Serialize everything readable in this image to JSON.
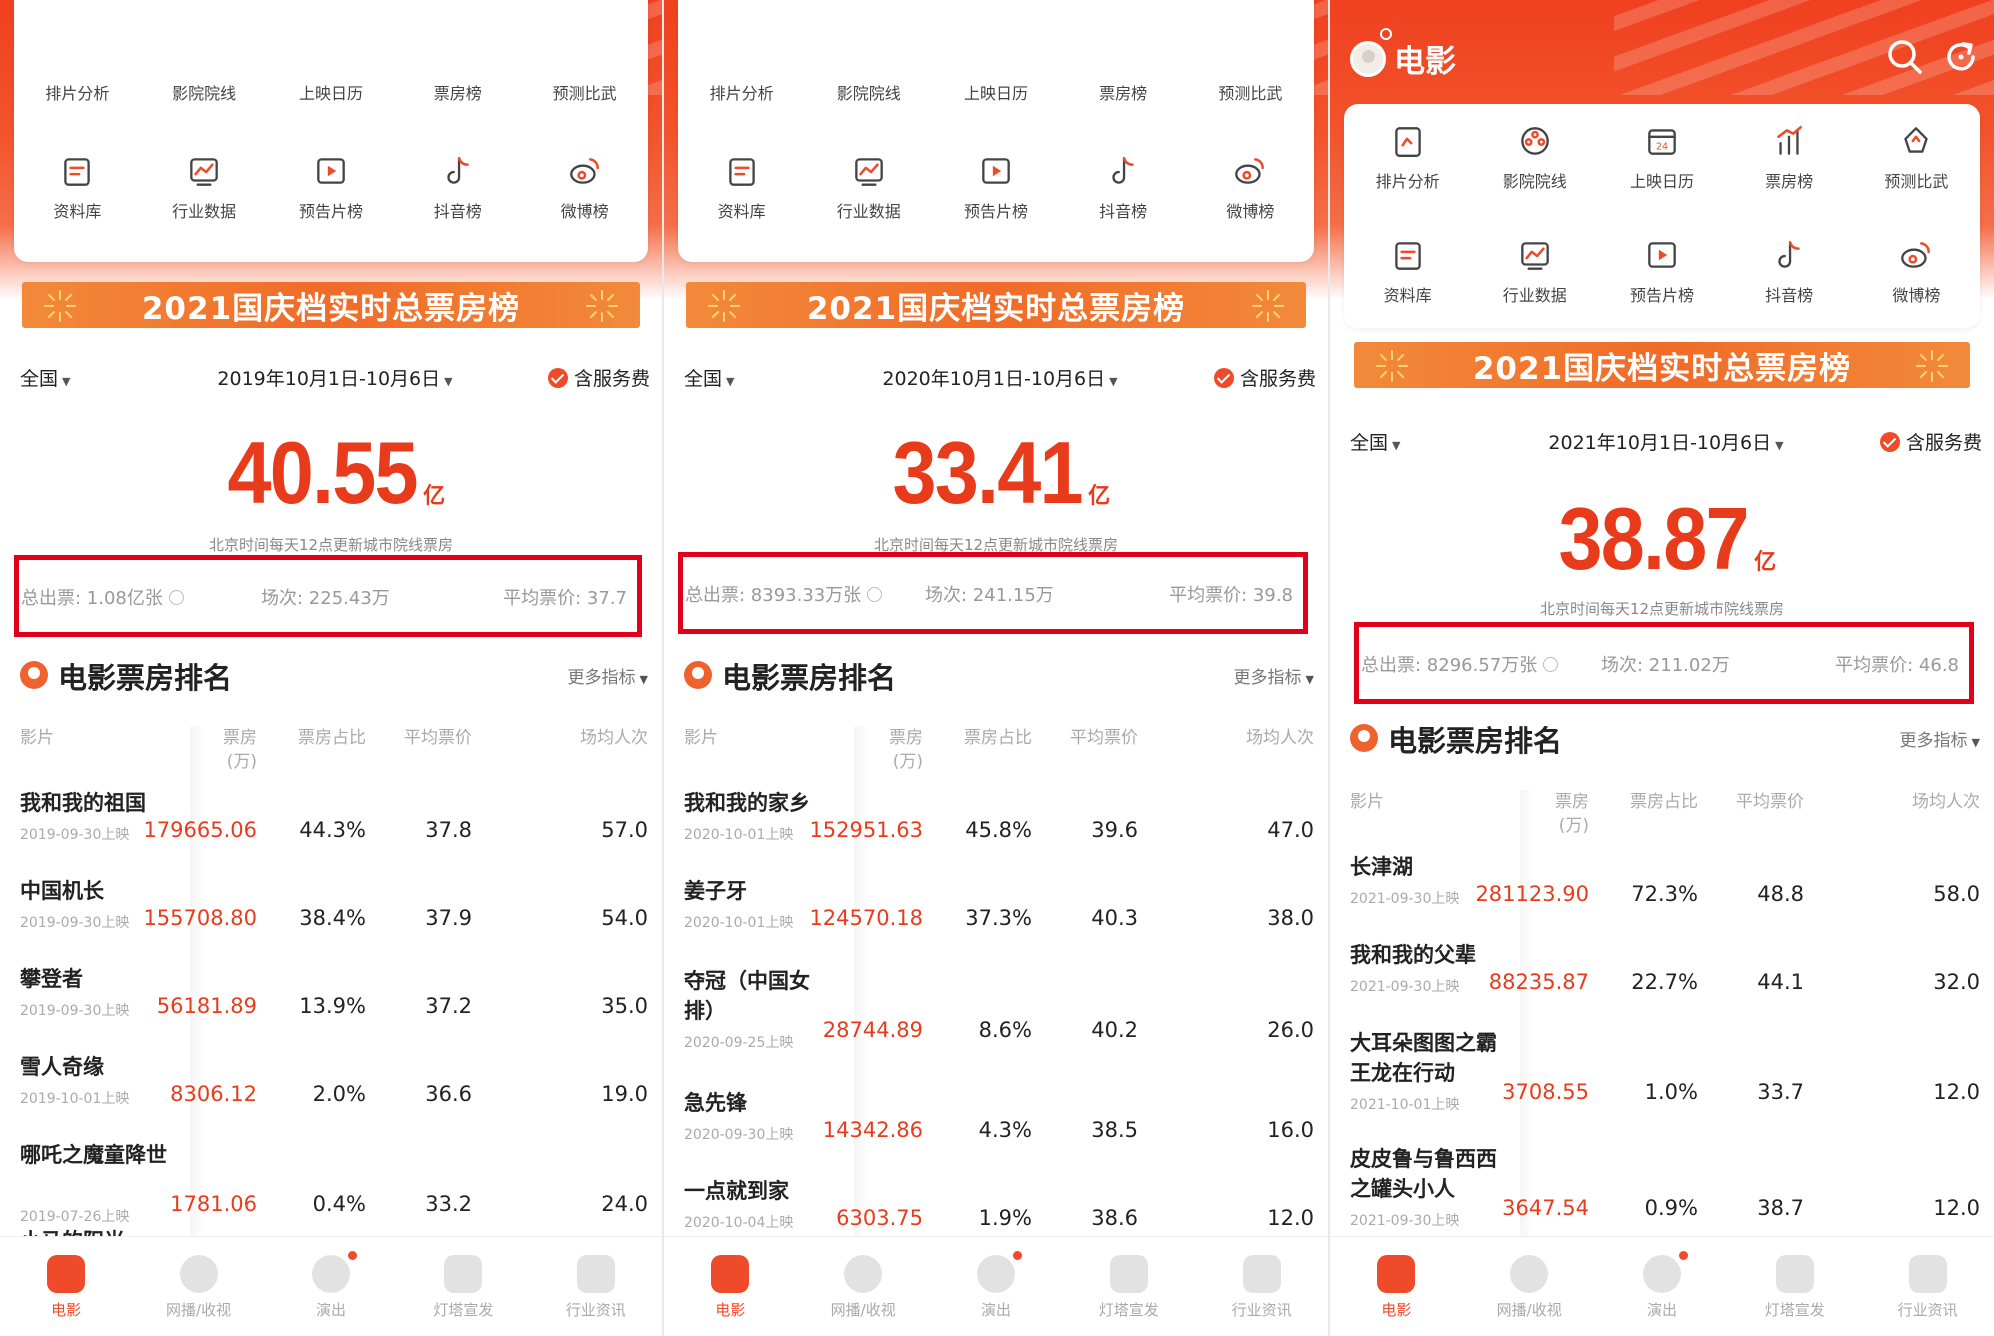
{
  "header": {
    "app_title": "电影"
  },
  "quick_grid": [
    {
      "label": "排片分析",
      "icon": "schedule-analysis-icon"
    },
    {
      "label": "影院院线",
      "icon": "cinema-chain-icon"
    },
    {
      "label": "上映日历",
      "icon": "release-calendar-icon"
    },
    {
      "label": "票房榜",
      "icon": "box-office-chart-icon"
    },
    {
      "label": "预测比武",
      "icon": "prediction-contest-icon"
    },
    {
      "label": "资料库",
      "icon": "database-icon"
    },
    {
      "label": "行业数据",
      "icon": "industry-data-icon"
    },
    {
      "label": "预告片榜",
      "icon": "trailer-chart-icon"
    },
    {
      "label": "抖音榜",
      "icon": "douyin-icon"
    },
    {
      "label": "微博榜",
      "icon": "weibo-icon"
    }
  ],
  "banner_title": "2021国庆档实时总票房榜",
  "region": "全国",
  "fee_label": "含服务费",
  "update_note": "北京时间每天12点更新城市院线票房",
  "unit_yi": "亿",
  "section": {
    "title": "电影票房排名",
    "more": "更多指标"
  },
  "table_headers": {
    "film": "影片",
    "box_office": "票房",
    "box_office_unit": "(万)",
    "share": "票房占比",
    "avg_price": "平均票价",
    "avg_attendance": "场均人次"
  },
  "tabs": [
    {
      "label": "电影",
      "active": true
    },
    {
      "label": "网播/收视",
      "active": false
    },
    {
      "label": "演出",
      "active": false
    },
    {
      "label": "灯塔宣发",
      "active": false
    },
    {
      "label": "行业资讯",
      "active": false
    }
  ],
  "accent_color": "#ef4a2a",
  "highlight_color": "#e0001a",
  "panels": [
    {
      "date_range": "2019年10月1日-10月6日",
      "total": "40.55",
      "stats": {
        "tickets": "总出票: 1.08亿张",
        "shows": "场次: 225.43万",
        "avg_price": "平均票价: 37.7"
      },
      "rows": [
        {
          "name": "我和我的祖国",
          "date": "2019-09-30上映",
          "box_office": "179665.06",
          "share": "44.3%",
          "avg_price": "37.8",
          "attendance": "57.0"
        },
        {
          "name": "中国机长",
          "date": "2019-09-30上映",
          "box_office": "155708.80",
          "share": "38.4%",
          "avg_price": "37.9",
          "attendance": "54.0"
        },
        {
          "name": "攀登者",
          "date": "2019-09-30上映",
          "box_office": "56181.89",
          "share": "13.9%",
          "avg_price": "37.2",
          "attendance": "35.0"
        },
        {
          "name": "雪人奇缘",
          "date": "2019-10-01上映",
          "box_office": "8306.12",
          "share": "2.0%",
          "avg_price": "36.6",
          "attendance": "19.0"
        },
        {
          "name": "哪吒之魔童降世",
          "date": "2019-07-26上映",
          "box_office": "1781.06",
          "share": "0.4%",
          "avg_price": "33.2",
          "attendance": "24.0"
        }
      ],
      "partial_row": "小马的阳光"
    },
    {
      "date_range": "2020年10月1日-10月6日",
      "total": "33.41",
      "stats": {
        "tickets": "总出票: 8393.33万张",
        "shows": "场次: 241.15万",
        "avg_price": "平均票价: 39.8"
      },
      "rows": [
        {
          "name": "我和我的家乡",
          "date": "2020-10-01上映",
          "box_office": "152951.63",
          "share": "45.8%",
          "avg_price": "39.6",
          "attendance": "47.0"
        },
        {
          "name": "姜子牙",
          "date": "2020-10-01上映",
          "box_office": "124570.18",
          "share": "37.3%",
          "avg_price": "40.3",
          "attendance": "38.0"
        },
        {
          "name": "夺冠（中国女排）",
          "date": "2020-09-25上映",
          "box_office": "28744.89",
          "share": "8.6%",
          "avg_price": "40.2",
          "attendance": "26.0"
        },
        {
          "name": "急先锋",
          "date": "2020-09-30上映",
          "box_office": "14342.86",
          "share": "4.3%",
          "avg_price": "38.5",
          "attendance": "16.0"
        },
        {
          "name": "一点就到家",
          "date": "2020-10-04上映",
          "box_office": "6303.75",
          "share": "1.9%",
          "avg_price": "38.6",
          "attendance": "12.0"
        }
      ]
    },
    {
      "date_range": "2021年10月1日-10月6日",
      "total": "38.87",
      "stats": {
        "tickets": "总出票: 8296.57万张",
        "shows": "场次: 211.02万",
        "avg_price": "平均票价: 46.8"
      },
      "rows": [
        {
          "name": "长津湖",
          "date": "2021-09-30上映",
          "box_office": "281123.90",
          "share": "72.3%",
          "avg_price": "48.8",
          "attendance": "58.0"
        },
        {
          "name": "我和我的父辈",
          "date": "2021-09-30上映",
          "box_office": "88235.87",
          "share": "22.7%",
          "avg_price": "44.1",
          "attendance": "32.0"
        },
        {
          "name": "大耳朵图图之霸王龙在行动",
          "date": "2021-10-01上映",
          "box_office": "3708.55",
          "share": "1.0%",
          "avg_price": "33.7",
          "attendance": "12.0"
        },
        {
          "name": "皮皮鲁与鲁西西之罐头小人",
          "date": "2021-09-30上映",
          "box_office": "3647.54",
          "share": "0.9%",
          "avg_price": "38.7",
          "attendance": "12.0"
        }
      ]
    }
  ]
}
